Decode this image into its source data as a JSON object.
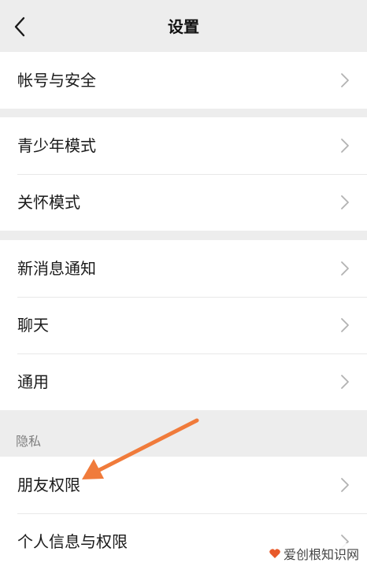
{
  "nav": {
    "title": "设置",
    "back_icon": "chevron-left-icon"
  },
  "groups": [
    {
      "items": [
        {
          "label": "帐号与安全"
        }
      ]
    },
    {
      "items": [
        {
          "label": "青少年模式"
        },
        {
          "label": "关怀模式"
        }
      ]
    },
    {
      "items": [
        {
          "label": "新消息通知"
        },
        {
          "label": "聊天"
        },
        {
          "label": "通用"
        }
      ]
    },
    {
      "header": "隐私",
      "items": [
        {
          "label": "朋友权限"
        },
        {
          "label": "个人信息与权限"
        }
      ]
    }
  ],
  "annotation": {
    "type": "arrow",
    "color": "#f07b3b",
    "points_to": "朋友权限"
  },
  "watermark": {
    "text": "爱创根知识网"
  },
  "colors": {
    "background": "#ededed",
    "row_background": "#ffffff",
    "text": "#1a1a1a",
    "section_header_text": "#7f7f7f",
    "chevron": "#b2b2b2"
  }
}
